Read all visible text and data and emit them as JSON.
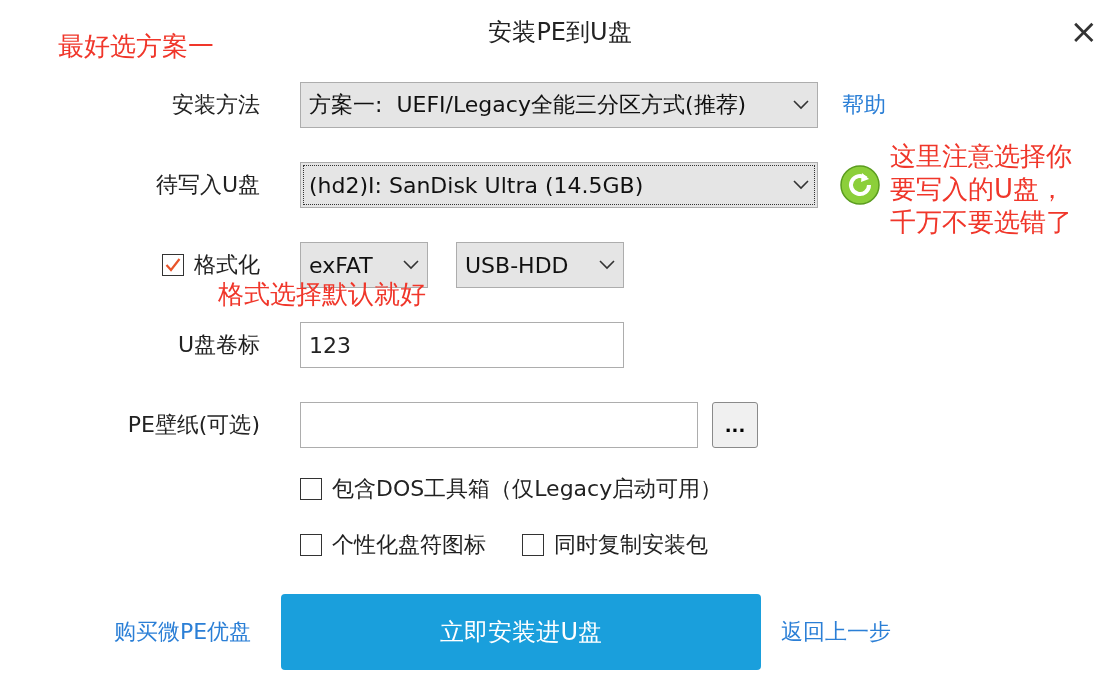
{
  "window": {
    "title": "安装PE到U盘",
    "close": "×"
  },
  "install_method": {
    "label": "安装方法",
    "value": "方案一:  UEFI/Legacy全能三分区方式(推荐)",
    "help_link": "帮助"
  },
  "target_disk": {
    "label": "待写入U盘",
    "value": "(hd2)I: SanDisk Ultra (14.5GB)"
  },
  "format": {
    "label": "格式化",
    "checked": true,
    "filesystem": "exFAT",
    "mode": "USB-HDD"
  },
  "volume_label": {
    "label": "U盘卷标",
    "value": "123"
  },
  "wallpaper": {
    "label": "PE壁纸(可选)",
    "browse": "..."
  },
  "options": [
    {
      "items": [
        {
          "label": "包含DOS工具箱（仅Legacy启动可用）",
          "checked": false
        }
      ]
    },
    {
      "items": [
        {
          "label": "个性化盘符图标",
          "checked": false
        },
        {
          "label": "同时复制安装包",
          "checked": false
        }
      ]
    }
  ],
  "footer": {
    "buy_link": "购买微PE优盘",
    "install_button": "立即安装进U盘",
    "back_link": "返回上一步"
  },
  "annotations": [
    {
      "text": "最好选方案一"
    },
    {
      "text": "这里注意选择你要写入的U盘，千万不要选错了"
    },
    {
      "text": "格式选择默认就好"
    }
  ]
}
